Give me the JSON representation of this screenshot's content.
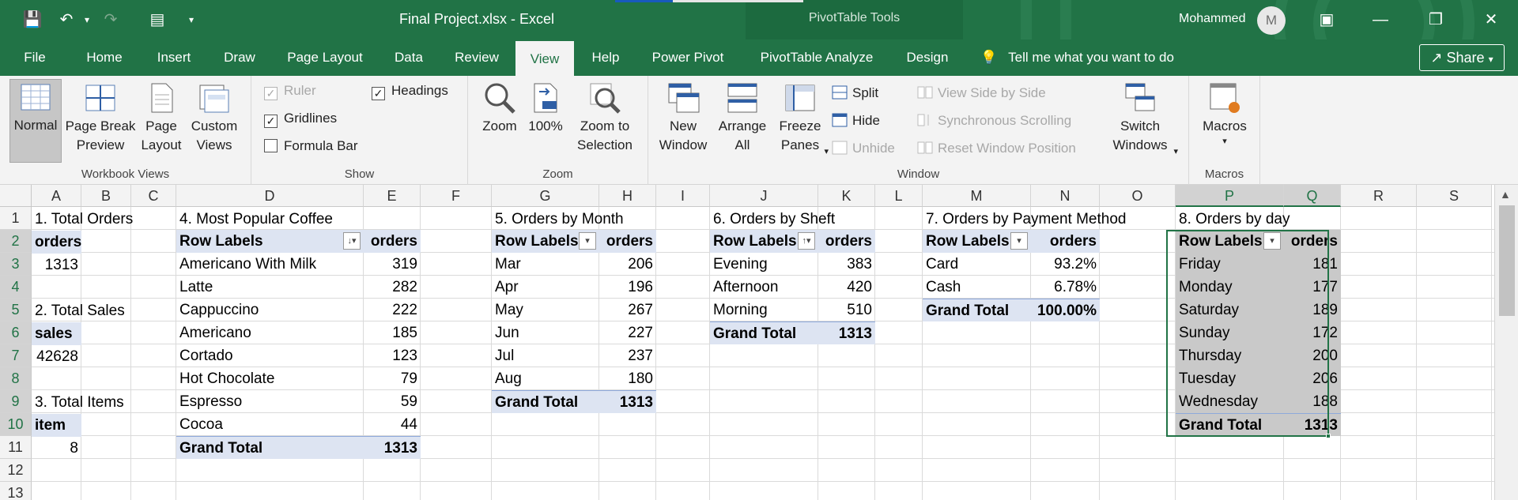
{
  "title": {
    "doc": "Final Project.xlsx  -  Excel",
    "context": "PivotTable Tools",
    "user": "Mohammed",
    "avatar": "M"
  },
  "quick_access": [
    "save-icon",
    "undo-icon",
    "redo-icon",
    "form-icon",
    "customize-icon"
  ],
  "tabs": [
    "File",
    "Home",
    "Insert",
    "Draw",
    "Page Layout",
    "Data",
    "Review",
    "View",
    "Help",
    "Power Pivot",
    "PivotTable Analyze",
    "Design"
  ],
  "active_tab": "View",
  "tell_me": "Tell me what you want to do",
  "share": "Share",
  "ribbon": {
    "workbook_views": {
      "label": "Workbook Views",
      "normal": "Normal",
      "page_break": "Page Break Preview",
      "page_layout": "Page Layout",
      "custom": "Custom Views"
    },
    "show": {
      "label": "Show",
      "ruler": "Ruler",
      "gridlines": "Gridlines",
      "formula_bar": "Formula Bar",
      "headings": "Headings"
    },
    "zoom": {
      "label": "Zoom",
      "zoom": "Zoom",
      "hundred": "100%",
      "selection": "Zoom to Selection"
    },
    "window": {
      "label": "Window",
      "new_window": "New Window",
      "arrange_all": "Arrange All",
      "freeze_panes": "Freeze Panes",
      "split": "Split",
      "hide": "Hide",
      "unhide": "Unhide",
      "side_by_side": "View Side by Side",
      "sync_scroll": "Synchronous Scrolling",
      "reset_pos": "Reset Window Position",
      "switch": "Switch Windows"
    },
    "macros": {
      "label": "Macros",
      "macros": "Macros"
    }
  },
  "columns": [
    "A",
    "B",
    "C",
    "D",
    "E",
    "F",
    "G",
    "H",
    "I",
    "J",
    "K",
    "L",
    "M",
    "N",
    "O",
    "P",
    "Q",
    "R",
    "S"
  ],
  "rows": [
    "1",
    "2",
    "3",
    "4",
    "5",
    "6",
    "7",
    "8",
    "9",
    "10",
    "11",
    "12",
    "13"
  ],
  "sheet": {
    "total_orders": {
      "title": "1. Total Orders",
      "header": "orders",
      "value": "1313"
    },
    "total_sales": {
      "title": "2. Total Sales",
      "header": "sales",
      "value": "42628"
    },
    "total_items": {
      "title": "3. Total Items",
      "header": "item",
      "value": "8"
    },
    "coffee": {
      "title": "4. Most Popular Coffee",
      "col1": "Row Labels",
      "col2": "orders",
      "rows": [
        [
          "Americano With Milk",
          "319"
        ],
        [
          "Latte",
          "282"
        ],
        [
          "Cappuccino",
          "222"
        ],
        [
          "Americano",
          "185"
        ],
        [
          "Cortado",
          "123"
        ],
        [
          "Hot Chocolate",
          "79"
        ],
        [
          "Espresso",
          "59"
        ],
        [
          "Cocoa",
          "44"
        ]
      ],
      "total": [
        "Grand Total",
        "1313"
      ]
    },
    "month": {
      "title": "5. Orders by Month",
      "col1": "Row Labels",
      "col2": "orders",
      "rows": [
        [
          "Mar",
          "206"
        ],
        [
          "Apr",
          "196"
        ],
        [
          "May",
          "267"
        ],
        [
          "Jun",
          "227"
        ],
        [
          "Jul",
          "237"
        ],
        [
          "Aug",
          "180"
        ]
      ],
      "total": [
        "Grand Total",
        "1313"
      ]
    },
    "shift": {
      "title": "6. Orders by Sheft",
      "col1": "Row Labels",
      "col2": "orders",
      "rows": [
        [
          "Evening",
          "383"
        ],
        [
          "Afternoon",
          "420"
        ],
        [
          "Morning",
          "510"
        ]
      ],
      "total": [
        "Grand Total",
        "1313"
      ]
    },
    "payment": {
      "title": "7. Orders by Payment Method",
      "col1": "Row Labels",
      "col2": "orders",
      "rows": [
        [
          "Card",
          "93.2%"
        ],
        [
          "Cash",
          "6.78%"
        ]
      ],
      "total": [
        "Grand Total",
        "100.00%"
      ]
    },
    "day": {
      "title": "8. Orders by day",
      "col1": "Row Labels",
      "col2": "orders",
      "rows": [
        [
          "Friday",
          "181"
        ],
        [
          "Monday",
          "177"
        ],
        [
          "Saturday",
          "189"
        ],
        [
          "Sunday",
          "172"
        ],
        [
          "Thursday",
          "200"
        ],
        [
          "Tuesday",
          "206"
        ],
        [
          "Wednesday",
          "188"
        ]
      ],
      "total": [
        "Grand Total",
        "1313"
      ]
    }
  }
}
